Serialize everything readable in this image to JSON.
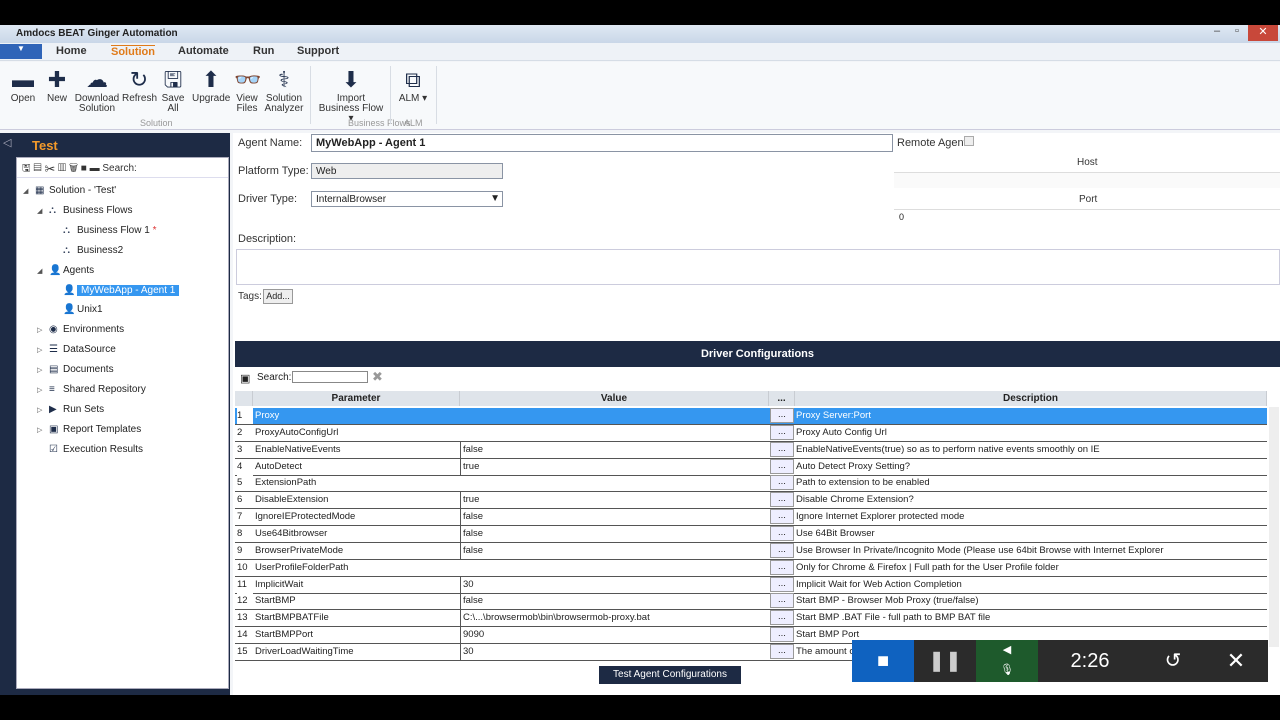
{
  "window": {
    "title": "Amdocs BEAT Ginger Automation"
  },
  "menu": [
    "Home",
    "Solution",
    "Automate",
    "Run",
    "Support"
  ],
  "ribbon": {
    "buttons": [
      {
        "label": "Open",
        "icon": "folder-icon"
      },
      {
        "label": "New",
        "icon": "plus-icon"
      },
      {
        "label": "Download Solution",
        "icon": "cloud-download-icon"
      },
      {
        "label": "Refresh",
        "icon": "refresh-icon"
      },
      {
        "label": "Save All",
        "icon": "save-icon"
      },
      {
        "label": "Upgrade",
        "icon": "upgrade-icon"
      },
      {
        "label": "View Files",
        "icon": "glasses-icon"
      },
      {
        "label": "Solution Analyzer",
        "icon": "stethoscope-icon"
      },
      {
        "label": "Import Business Flow ▾",
        "icon": "import-file-icon"
      },
      {
        "label": "ALM ▾",
        "icon": "alm-icon"
      }
    ],
    "groups": [
      "Solution",
      "Business Flows",
      "ALM"
    ]
  },
  "sidebar": {
    "title": "Test",
    "search_label": "Search:",
    "tree": [
      {
        "label": "Solution - 'Test'",
        "level": 0,
        "arrow": "◢",
        "icon": "▦"
      },
      {
        "label": "Business Flows",
        "level": 1,
        "arrow": "◢",
        "icon": "⛬"
      },
      {
        "label": "Business Flow 1",
        "level": 2,
        "arrow": "",
        "icon": "⛬",
        "star": "*"
      },
      {
        "label": "Business2",
        "level": 2,
        "arrow": "",
        "icon": "⛬"
      },
      {
        "label": "Agents",
        "level": 1,
        "arrow": "◢",
        "icon": "👤"
      },
      {
        "label": "MyWebApp - Agent 1",
        "level": 2,
        "arrow": "",
        "icon": "👤",
        "selected": true
      },
      {
        "label": "Unix1",
        "level": 2,
        "arrow": "",
        "icon": "👤"
      },
      {
        "label": "Environments",
        "level": 1,
        "arrow": "▷",
        "icon": "◉"
      },
      {
        "label": "DataSource",
        "level": 1,
        "arrow": "▷",
        "icon": "☰"
      },
      {
        "label": "Documents",
        "level": 1,
        "arrow": "▷",
        "icon": "▤"
      },
      {
        "label": "Shared Repository",
        "level": 1,
        "arrow": "▷",
        "icon": "≡"
      },
      {
        "label": "Run Sets",
        "level": 1,
        "arrow": "▷",
        "icon": "▶"
      },
      {
        "label": "Report Templates",
        "level": 1,
        "arrow": "▷",
        "icon": "▣"
      },
      {
        "label": "Execution Results",
        "level": 1,
        "arrow": "",
        "icon": "☑"
      }
    ]
  },
  "agent": {
    "name_label": "Agent Name:",
    "name": "MyWebApp - Agent 1",
    "platform_label": "Platform Type:",
    "platform": "Web",
    "driver_label": "Driver Type:",
    "driver": "InternalBrowser",
    "description_label": "Description:",
    "tags_label": "Tags:",
    "add_label": "Add...",
    "remote_label": "Remote Agent",
    "host_label": "Host",
    "host": "",
    "port_label": "Port",
    "port": "0"
  },
  "driver_config": {
    "title": "Driver Configurations",
    "search_label": "Search:",
    "columns": [
      "Parameter",
      "Value",
      "...",
      "Description"
    ],
    "rows": [
      [
        "1",
        "Proxy",
        "",
        "Proxy Server:Port"
      ],
      [
        "2",
        "ProxyAutoConfigUrl",
        "",
        "Proxy Auto Config Url"
      ],
      [
        "3",
        "EnableNativeEvents",
        "false",
        "EnableNativeEvents(true) so as to perform native events smoothly on IE"
      ],
      [
        "4",
        "AutoDetect",
        "true",
        "Auto Detect Proxy Setting?"
      ],
      [
        "5",
        "ExtensionPath",
        "",
        "Path to extension to be enabled"
      ],
      [
        "6",
        "DisableExtension",
        "true",
        "Disable Chrome Extension?"
      ],
      [
        "7",
        "IgnoreIEProtectedMode",
        "false",
        "Ignore Internet Explorer protected mode"
      ],
      [
        "8",
        "Use64Bitbrowser",
        "false",
        "Use 64Bit Browser"
      ],
      [
        "9",
        "BrowserPrivateMode",
        "false",
        "Use Browser In Private/Incognito Mode (Please use 64bit Browse with Internet Explorer"
      ],
      [
        "10",
        "UserProfileFolderPath",
        "",
        "Only for Chrome & Firefox | Full path for the User Profile folder"
      ],
      [
        "11",
        "ImplicitWait",
        "30",
        "Implicit Wait for Web Action Completion"
      ],
      [
        "12",
        "StartBMP",
        "false",
        "Start BMP - Browser Mob Proxy (true/false)"
      ],
      [
        "13",
        "StartBMPBATFile",
        "C:\\...\\browsermob\\bin\\browsermob-proxy.bat",
        "Start BMP .BAT File - full path to BMP BAT file"
      ],
      [
        "14",
        "StartBMPPort",
        "9090",
        "Start BMP Port"
      ],
      [
        "15",
        "DriverLoadWaitingTime",
        "30",
        "The amount o"
      ]
    ],
    "test_button": "Test Agent Configurations"
  },
  "recorder": {
    "time": "2:26"
  },
  "colors": {
    "accent": "#3597f0",
    "navy": "#1d2a44",
    "orange": "#f39a2b"
  }
}
